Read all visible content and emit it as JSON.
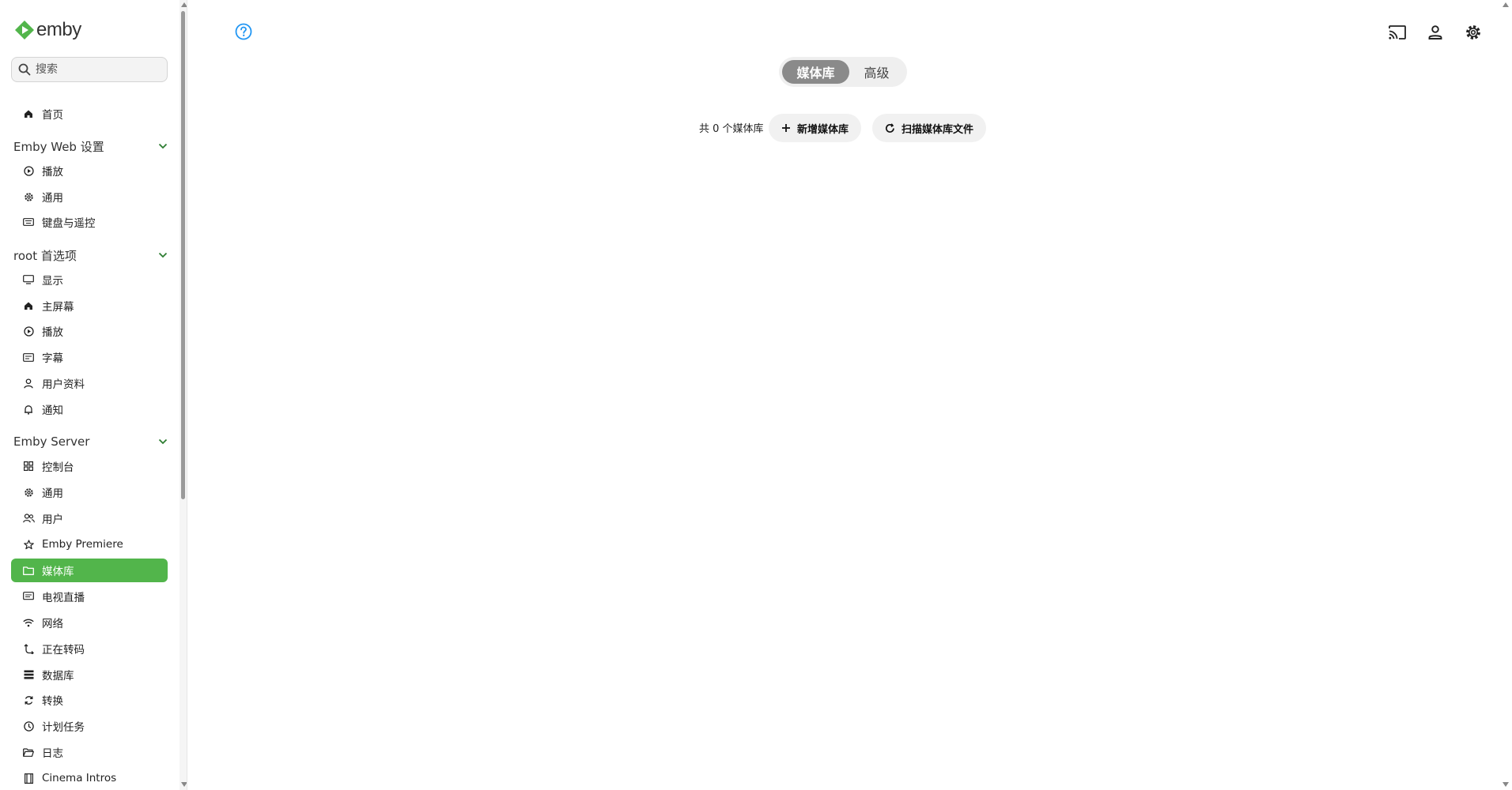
{
  "app": {
    "logo_text": "emby",
    "brand_color": "#52b54b"
  },
  "search": {
    "placeholder": "搜索"
  },
  "sidebar": {
    "home": "首页",
    "sections": [
      {
        "title": "Emby Web 设置",
        "items": [
          {
            "label": "播放",
            "icon": "play-circle-icon"
          },
          {
            "label": "通用",
            "icon": "gear-icon"
          },
          {
            "label": "键盘与遥控",
            "icon": "keyboard-icon"
          }
        ]
      },
      {
        "title": "root 首选项",
        "items": [
          {
            "label": "显示",
            "icon": "monitor-icon"
          },
          {
            "label": "主屏幕",
            "icon": "home-icon"
          },
          {
            "label": "播放",
            "icon": "play-circle-icon"
          },
          {
            "label": "字幕",
            "icon": "subtitles-icon"
          },
          {
            "label": "用户资料",
            "icon": "person-icon"
          },
          {
            "label": "通知",
            "icon": "bell-icon"
          }
        ]
      },
      {
        "title": "Emby Server",
        "items": [
          {
            "label": "控制台",
            "icon": "dashboard-icon"
          },
          {
            "label": "通用",
            "icon": "gear-icon"
          },
          {
            "label": "用户",
            "icon": "people-icon"
          },
          {
            "label": "Emby Premiere",
            "icon": "star-icon"
          },
          {
            "label": "媒体库",
            "icon": "folder-icon",
            "active": true
          },
          {
            "label": "电视直播",
            "icon": "tv-icon"
          },
          {
            "label": "网络",
            "icon": "wifi-icon"
          },
          {
            "label": "正在转码",
            "icon": "transcode-icon"
          },
          {
            "label": "数据库",
            "icon": "database-icon"
          },
          {
            "label": "转换",
            "icon": "convert-icon"
          },
          {
            "label": "计划任务",
            "icon": "clock-icon"
          },
          {
            "label": "日志",
            "icon": "folder-open-icon"
          },
          {
            "label": "Cinema Intros",
            "icon": "film-icon"
          }
        ]
      }
    ]
  },
  "header": {
    "help_icon": "help-circle-icon",
    "cast_icon": "cast-icon",
    "user_icon": "user-icon",
    "settings_icon": "gear-icon"
  },
  "main": {
    "tabs": [
      {
        "label": "媒体库",
        "active": true
      },
      {
        "label": "高级",
        "active": false
      }
    ],
    "count_text": "共 0 个媒体库",
    "add_button": "新增媒体库",
    "scan_button": "扫描媒体库文件"
  }
}
